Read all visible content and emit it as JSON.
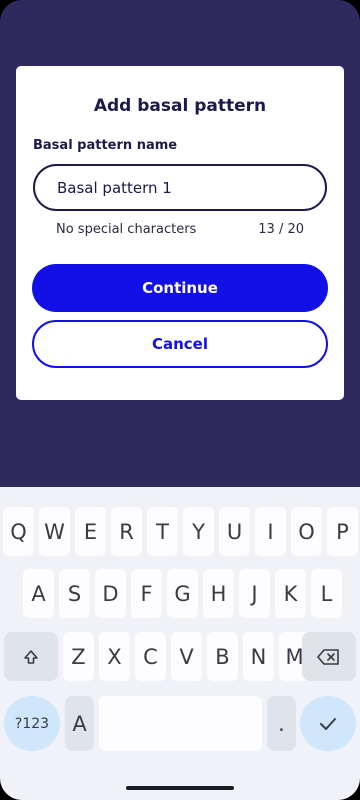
{
  "dialog": {
    "title": "Add basal pattern",
    "field_label": "Basal pattern name",
    "input_value": "Basal pattern 1",
    "helper_text": "No special characters",
    "char_counter": "13 / 20",
    "continue_label": "Continue",
    "cancel_label": "Cancel"
  },
  "keyboard": {
    "row1": [
      "Q",
      "W",
      "E",
      "R",
      "T",
      "Y",
      "U",
      "I",
      "O",
      "P"
    ],
    "row2": [
      "A",
      "S",
      "D",
      "F",
      "G",
      "H",
      "J",
      "K",
      "L"
    ],
    "row3": [
      "Z",
      "X",
      "C",
      "V",
      "B",
      "N",
      "M"
    ],
    "symbols_label": "?123",
    "mode_key_label": "A",
    "period_label": ".",
    "icons": {
      "shift": "shift-icon",
      "backspace": "backspace-icon",
      "enter": "check-icon"
    }
  },
  "colors": {
    "backdrop": "#2e2a5e",
    "primary": "#1210e6",
    "text_dark": "#1c1a4a",
    "keyboard_bg": "#f1f2f8",
    "action_key": "#cfe6fb"
  }
}
